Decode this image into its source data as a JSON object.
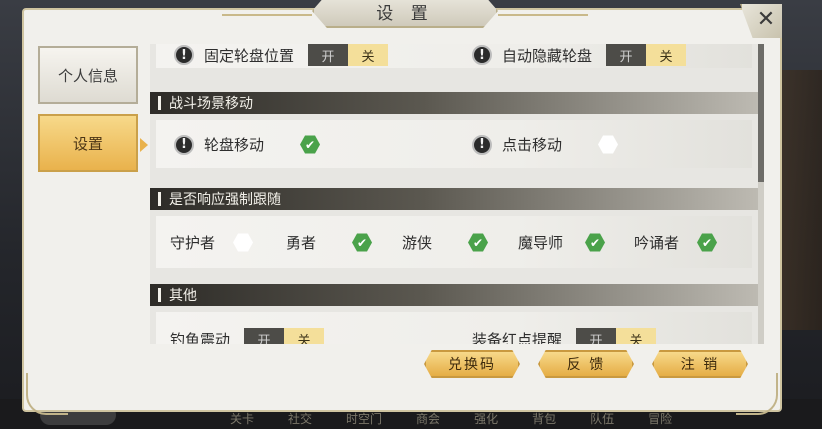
{
  "window": {
    "title": "设 置",
    "close_label": "✕"
  },
  "sidebar": {
    "items": [
      {
        "label": "个人信息",
        "active": false
      },
      {
        "label": "设置",
        "active": true
      }
    ]
  },
  "top_row": {
    "fixed_wheel": {
      "label": "固定轮盘位置",
      "on": "开",
      "off": "关"
    },
    "auto_hide_wheel": {
      "label": "自动隐藏轮盘",
      "on": "开",
      "off": "关"
    }
  },
  "battle_move": {
    "header": "战斗场景移动",
    "wheel_move": {
      "label": "轮盘移动",
      "checked": true
    },
    "tap_move": {
      "label": "点击移动",
      "checked": false
    }
  },
  "follow": {
    "header": "是否响应强制跟随",
    "roles": [
      {
        "label": "守护者",
        "checked": false
      },
      {
        "label": "勇者",
        "checked": true
      },
      {
        "label": "游侠",
        "checked": true
      },
      {
        "label": "魔导师",
        "checked": true
      },
      {
        "label": "吟诵者",
        "checked": true
      }
    ]
  },
  "other": {
    "header": "其他",
    "fishing_vibrate": {
      "label": "钓鱼震动",
      "on": "开",
      "off": "关"
    },
    "equip_reddot": {
      "label": "装备红点提醒",
      "on": "开",
      "off": "关"
    }
  },
  "buttons": {
    "redeem": "兑换码",
    "feedback": "反 馈",
    "logout": "注 销"
  },
  "background_nav": [
    "关卡",
    "社交",
    "时空门",
    "商会",
    "强化",
    "背包",
    "队伍",
    "冒险"
  ],
  "colors": {
    "accent_gold": "#e9b24c",
    "check_green": "#4aa24a",
    "header_dark": "#2d2b27"
  }
}
